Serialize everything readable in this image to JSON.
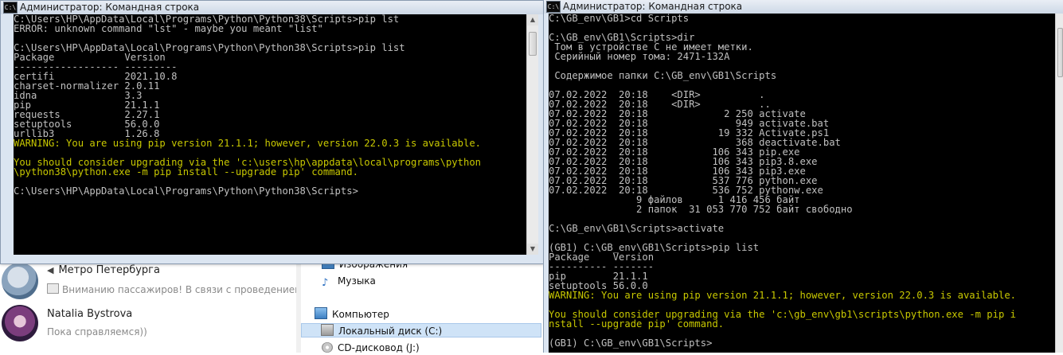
{
  "chats": [
    {
      "title": "Метро Петербурга",
      "message": "Вниманию пассажиров! В связи с проведением"
    },
    {
      "title": "Natalia Bystrova",
      "message": "Пока справляемся))"
    }
  ],
  "explorer": {
    "items": [
      {
        "label": "Изображения",
        "icon": "images-icon"
      },
      {
        "label": "Музыка",
        "icon": "music-icon"
      },
      {
        "label": "Компьютер",
        "icon": "computer-icon"
      },
      {
        "label": "Локальный диск (C:)",
        "icon": "disk-icon"
      },
      {
        "label": "CD-дисковод (J:)",
        "icon": "cd-icon"
      }
    ]
  },
  "left_window": {
    "title": "Администратор: Командная строка",
    "icon_text": "C:\\",
    "lines": [
      {
        "text": "C:\\Users\\HP\\AppData\\Local\\Programs\\Python\\Python38\\Scripts>pip lst",
        "type": "ok"
      },
      {
        "text": "ERROR: unknown command \"lst\" - maybe you meant \"list\"",
        "type": "ok"
      },
      {
        "text": "",
        "type": "ok"
      },
      {
        "text": "C:\\Users\\HP\\AppData\\Local\\Programs\\Python\\Python38\\Scripts>pip list",
        "type": "ok"
      },
      {
        "text": "Package            Version",
        "type": "ok"
      },
      {
        "text": "------------------ ---------",
        "type": "ok"
      },
      {
        "text": "certifi            2021.10.8",
        "type": "ok"
      },
      {
        "text": "charset-normalizer 2.0.11",
        "type": "ok"
      },
      {
        "text": "idna               3.3",
        "type": "ok"
      },
      {
        "text": "pip                21.1.1",
        "type": "ok"
      },
      {
        "text": "requests           2.27.1",
        "type": "ok"
      },
      {
        "text": "setuptools         56.0.0",
        "type": "ok"
      },
      {
        "text": "urllib3            1.26.8",
        "type": "ok"
      },
      {
        "text": "WARNING: You are using pip version 21.1.1; however, version 22.0.3 is available.",
        "type": "warn"
      },
      {
        "text": "",
        "type": "warn"
      },
      {
        "text": "You should consider upgrading via the 'c:\\users\\hp\\appdata\\local\\programs\\python",
        "type": "warn"
      },
      {
        "text": "\\python38\\python.exe -m pip install --upgrade pip' command.",
        "type": "warn"
      },
      {
        "text": "",
        "type": "ok"
      },
      {
        "text": "C:\\Users\\HP\\AppData\\Local\\Programs\\Python\\Python38\\Scripts>",
        "type": "ok"
      }
    ]
  },
  "right_window": {
    "title": "Администратор: Командная строка",
    "icon_text": "C:\\",
    "lines": [
      {
        "text": "C:\\GB_env\\GB1>cd Scripts",
        "type": "ok"
      },
      {
        "text": "",
        "type": "ok"
      },
      {
        "text": "C:\\GB_env\\GB1\\Scripts>dir",
        "type": "ok"
      },
      {
        "text": " Том в устройстве C не имеет метки.",
        "type": "ok"
      },
      {
        "text": " Серийный номер тома: 2471-132A",
        "type": "ok"
      },
      {
        "text": "",
        "type": "ok"
      },
      {
        "text": " Содержимое папки C:\\GB_env\\GB1\\Scripts",
        "type": "ok"
      },
      {
        "text": "",
        "type": "ok"
      },
      {
        "text": "07.02.2022  20:18    <DIR>          .",
        "type": "ok"
      },
      {
        "text": "07.02.2022  20:18    <DIR>          ..",
        "type": "ok"
      },
      {
        "text": "07.02.2022  20:18             2 250 activate",
        "type": "ok"
      },
      {
        "text": "07.02.2022  20:18               949 activate.bat",
        "type": "ok"
      },
      {
        "text": "07.02.2022  20:18            19 332 Activate.ps1",
        "type": "ok"
      },
      {
        "text": "07.02.2022  20:18               368 deactivate.bat",
        "type": "ok"
      },
      {
        "text": "07.02.2022  20:18           106 343 pip.exe",
        "type": "ok"
      },
      {
        "text": "07.02.2022  20:18           106 343 pip3.8.exe",
        "type": "ok"
      },
      {
        "text": "07.02.2022  20:18           106 343 pip3.exe",
        "type": "ok"
      },
      {
        "text": "07.02.2022  20:18           537 776 python.exe",
        "type": "ok"
      },
      {
        "text": "07.02.2022  20:18           536 752 pythonw.exe",
        "type": "ok"
      },
      {
        "text": "               9 файлов      1 416 456 байт",
        "type": "ok"
      },
      {
        "text": "               2 папок  31 053 770 752 байт свободно",
        "type": "ok"
      },
      {
        "text": "",
        "type": "ok"
      },
      {
        "text": "C:\\GB_env\\GB1\\Scripts>activate",
        "type": "ok"
      },
      {
        "text": "",
        "type": "ok"
      },
      {
        "text": "(GB1) C:\\GB_env\\GB1\\Scripts>pip list",
        "type": "ok"
      },
      {
        "text": "Package    Version",
        "type": "ok"
      },
      {
        "text": "---------- -------",
        "type": "ok"
      },
      {
        "text": "pip        21.1.1",
        "type": "ok"
      },
      {
        "text": "setuptools 56.0.0",
        "type": "ok"
      },
      {
        "text": "WARNING: You are using pip version 21.1.1; however, version 22.0.3 is available.",
        "type": "warn"
      },
      {
        "text": "",
        "type": "warn"
      },
      {
        "text": "You should consider upgrading via the 'c:\\gb_env\\gb1\\scripts\\python.exe -m pip i",
        "type": "warn"
      },
      {
        "text": "nstall --upgrade pip' command.",
        "type": "warn"
      },
      {
        "text": "",
        "type": "ok"
      },
      {
        "text": "(GB1) C:\\GB_env\\GB1\\Scripts>",
        "type": "ok"
      }
    ]
  }
}
